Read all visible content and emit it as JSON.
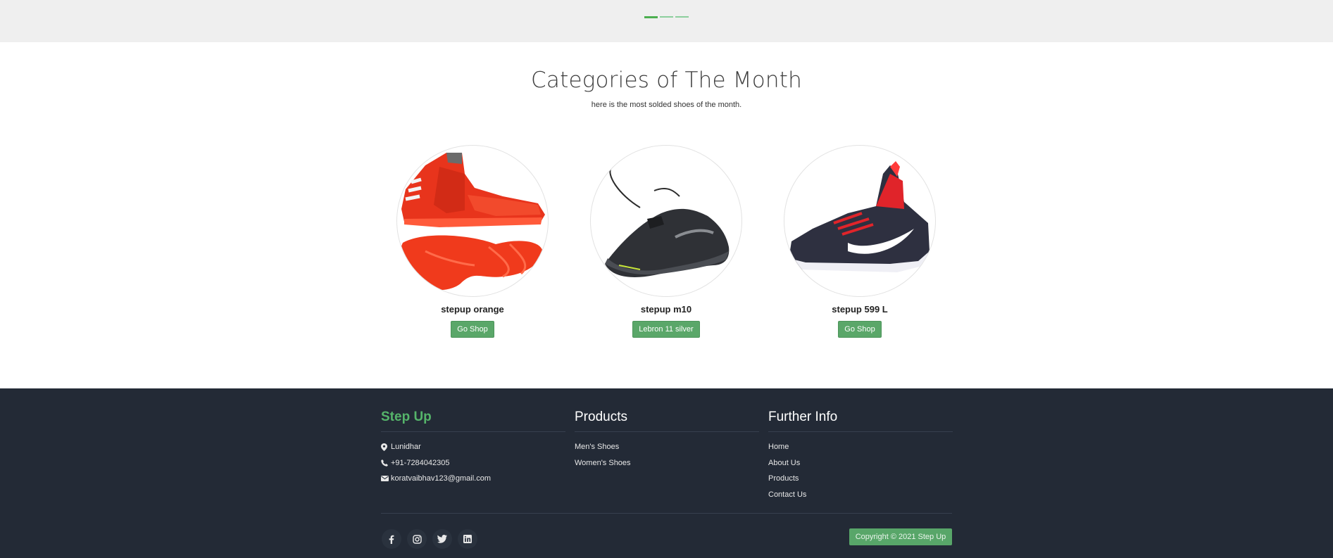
{
  "slider": {
    "indicators": [
      "slide-1",
      "slide-2",
      "slide-3"
    ],
    "active": 0
  },
  "section": {
    "title": "Categories of The Month",
    "subtitle": "here is the most solded shoes of the month."
  },
  "products": [
    {
      "name": "stepup orange",
      "button": "Go Shop",
      "image": "red basketball shoe"
    },
    {
      "name": "stepup m10",
      "button": "Lebron 11 silver",
      "image": "black running shoe"
    },
    {
      "name": "stepup 599 L",
      "button": "Go Shop",
      "image": "navy red basketball shoe"
    }
  ],
  "footer": {
    "brand": {
      "title": "Step Up",
      "address": "Lunidhar",
      "phone": "+91-7284042305",
      "email": "koratvaibhav123@gmail.com"
    },
    "products": {
      "title": "Products",
      "links": [
        "Men's Shoes",
        "Women's Shoes"
      ]
    },
    "info": {
      "title": "Further Info",
      "links": [
        "Home",
        "About Us",
        "Products",
        "Contact Us"
      ]
    },
    "social": [
      "facebook-icon",
      "instagram-icon",
      "twitter-icon",
      "linkedin-icon"
    ],
    "copyright": "Copyright © 2021 Step Up",
    "colors": {
      "background": "#232a36",
      "accent": "#55b46a"
    }
  }
}
